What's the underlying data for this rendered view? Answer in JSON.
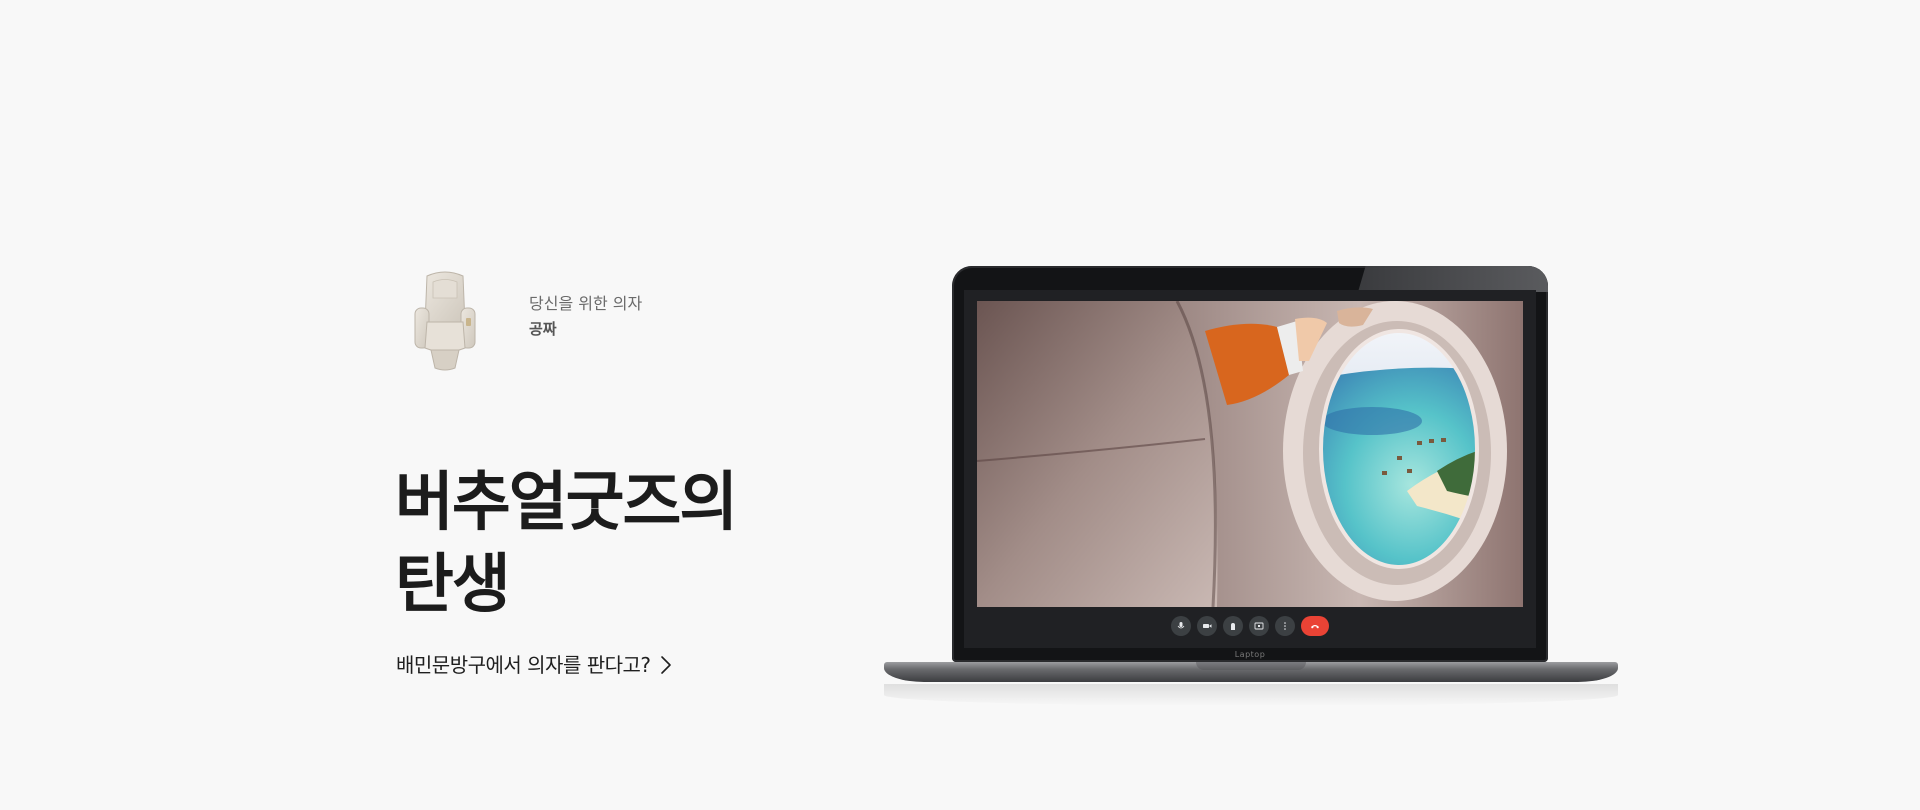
{
  "product": {
    "subtitle": "당신을 위한 의자",
    "name": "공짜",
    "thumbnail_icon": "chair-icon"
  },
  "headline": {
    "line1": "버추얼굿즈의",
    "line2": "탄생"
  },
  "cta": {
    "label": "배민문방구에서 의자를 판다고?",
    "icon": "chevron-right-icon"
  },
  "laptop": {
    "label": "Laptop",
    "video_scene": "airplane-window-view",
    "controls": [
      "microphone-icon",
      "camera-icon",
      "raise-hand-icon",
      "present-screen-icon",
      "more-options-icon",
      "end-call-icon"
    ]
  },
  "colors": {
    "background": "#f8f8f8",
    "headline": "#1c1c1c",
    "end_call": "#ea4335",
    "control": "#3c4043"
  }
}
